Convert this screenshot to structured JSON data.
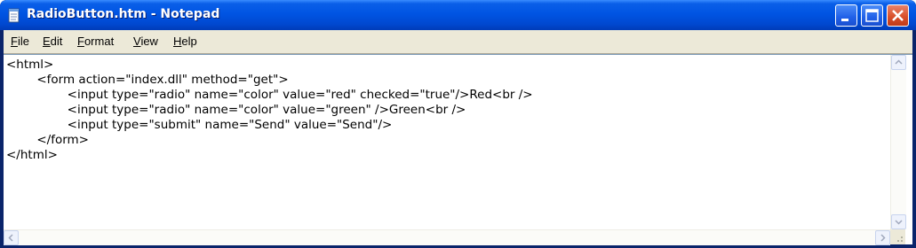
{
  "window": {
    "title": "RadioButton.htm - Notepad",
    "app_icon": "notepad-icon",
    "controls": [
      "minimize-icon",
      "maximize-icon",
      "close-icon"
    ],
    "colors": {
      "titlebar": "#0054e3",
      "close": "#d9512c",
      "menubar": "#ece9d8"
    }
  },
  "menu": {
    "items": [
      {
        "mnemonic": "F",
        "rest": "ile"
      },
      {
        "mnemonic": "E",
        "rest": "dit"
      },
      {
        "mnemonic": "F",
        "rest": "ormat"
      },
      {
        "mnemonic": "V",
        "rest": "iew"
      },
      {
        "mnemonic": "H",
        "rest": "elp"
      }
    ]
  },
  "editor": {
    "lines": [
      "<html>",
      "\t<form action=\"index.dll\" method=\"get\">",
      "\t\t<input type=\"radio\" name=\"color\" value=\"red\" checked=\"true\"/>Red<br />",
      "\t\t<input type=\"radio\" name=\"color\" value=\"green\" />Green<br />",
      "\t\t<input type=\"submit\" name=\"Send\" value=\"Send\"/>",
      "\t</form>",
      "</html>"
    ]
  }
}
